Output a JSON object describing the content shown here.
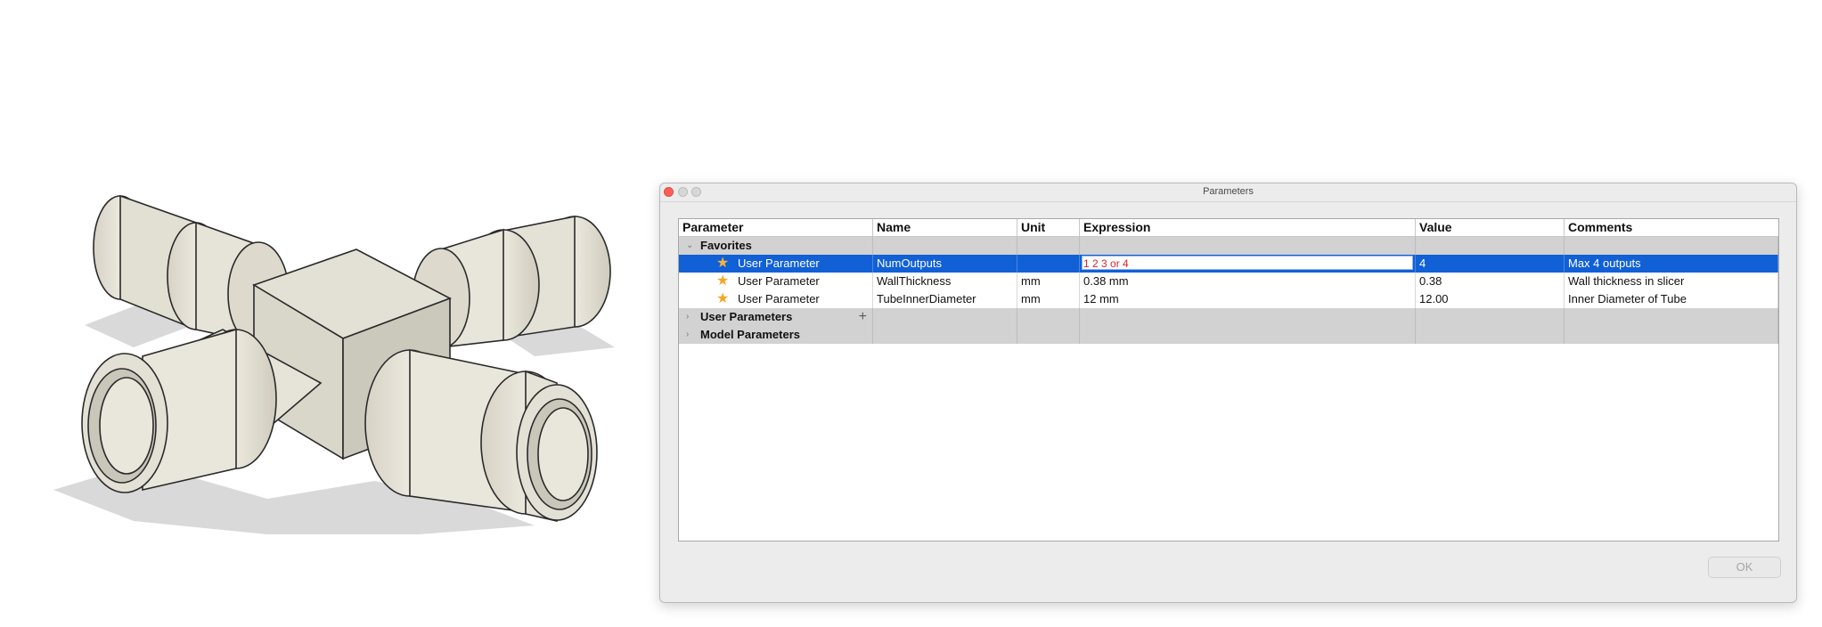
{
  "window": {
    "title": "Parameters"
  },
  "table": {
    "columns": [
      "Parameter",
      "Name",
      "Unit",
      "Expression",
      "Value",
      "Comments"
    ],
    "groups": {
      "favorites": "Favorites",
      "user_parameters": "User Parameters",
      "model_parameters": "Model Parameters"
    },
    "favorite_rows": [
      {
        "parameter": "User Parameter",
        "name": "NumOutputs",
        "unit": "",
        "expression": "1 2 3 or 4",
        "value": "4",
        "comment": "Max 4 outputs",
        "selected": true
      },
      {
        "parameter": "User Parameter",
        "name": "WallThickness",
        "unit": "mm",
        "expression": "0.38 mm",
        "value": "0.38",
        "comment": "Wall thickness in slicer",
        "selected": false
      },
      {
        "parameter": "User Parameter",
        "name": "TubeInnerDiameter",
        "unit": "mm",
        "expression": "12 mm",
        "value": "12.00",
        "comment": "Inner Diameter of Tube",
        "selected": false
      }
    ]
  },
  "buttons": {
    "ok": "OK"
  },
  "icons": {
    "favorite": "star-icon",
    "expand": "chevron-right-icon",
    "collapse": "chevron-down-icon",
    "add": "plus-icon"
  },
  "colors": {
    "selection": "#1160d6",
    "star": "#f5a623",
    "expression_error": "#e1222c",
    "group_background": "#d2d2d2"
  }
}
